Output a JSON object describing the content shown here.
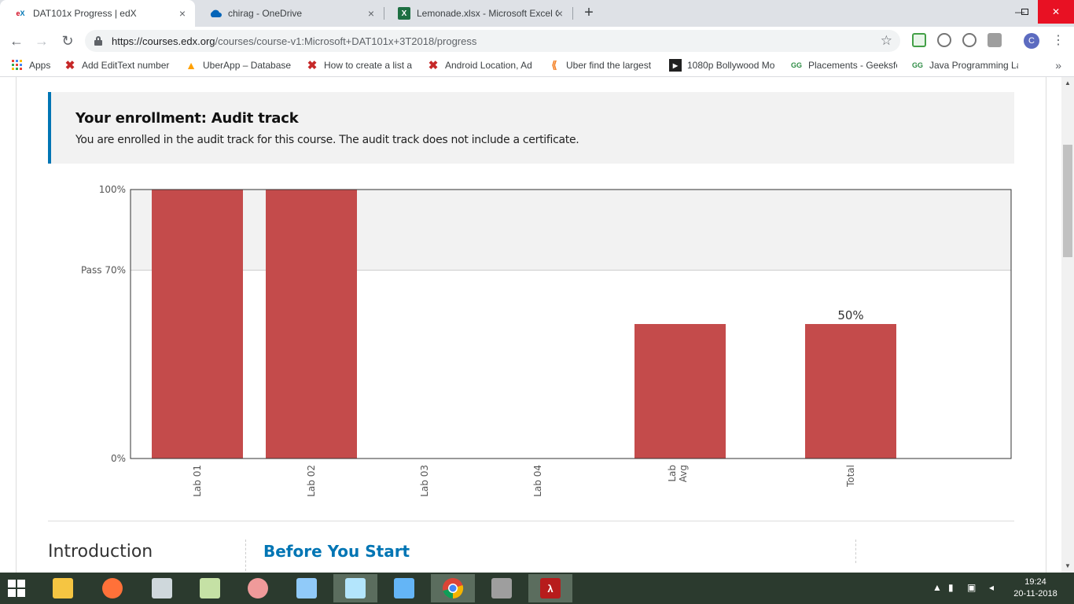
{
  "browser": {
    "tabs": [
      {
        "title": "DAT101x Progress | edX",
        "icon": "edx-favicon",
        "active": true
      },
      {
        "title": "chirag - OneDrive",
        "icon": "onedrive-cloud-icon",
        "active": false
      },
      {
        "title": "Lemonade.xlsx - Microsoft Excel O",
        "icon": "excel-icon",
        "active": false
      }
    ],
    "new_tab_symbol": "+",
    "close_symbol": "×",
    "url_domain": "https://courses.edx.org",
    "url_path": "/courses/course-v1:Microsoft+DAT101x+3T2018/progress",
    "profile_initial": "C"
  },
  "bookmarks": [
    {
      "label": "Apps",
      "icon": "apps-grid-icon"
    },
    {
      "label": "Add EditText number",
      "icon": "x-logo-icon"
    },
    {
      "label": "UberApp – Database",
      "icon": "firebase-icon"
    },
    {
      "label": "How to create a list a",
      "icon": "x-logo-icon"
    },
    {
      "label": "Android Location, Ad",
      "icon": "x-logo-icon"
    },
    {
      "label": "Uber find the largest",
      "icon": "stackoverflow-icon"
    },
    {
      "label": "1080p Bollywood Mo",
      "icon": "play-icon"
    },
    {
      "label": "Placements - Geeksfc",
      "icon": "geeksforgeeks-icon"
    },
    {
      "label": "Java Programming La",
      "icon": "geeksforgeeks-icon"
    }
  ],
  "enrollment": {
    "title": "Your enrollment: Audit track",
    "message": "You are enrolled in the audit track for this course. The audit track does not include a certificate."
  },
  "chart_data": {
    "type": "bar",
    "categories": [
      "Lab 01",
      "Lab 02",
      "Lab 03",
      "Lab 04",
      "Lab Avg",
      "Total"
    ],
    "values": [
      100,
      100,
      0,
      0,
      50,
      50
    ],
    "ylim": [
      0,
      100
    ],
    "y_tick_labels": [
      "0%",
      "Pass 70%",
      "100%"
    ],
    "y_tick_values": [
      0,
      70,
      100
    ],
    "pass_threshold": 70,
    "data_labels": [
      {
        "category": "Total",
        "text": "50%"
      }
    ],
    "bar_color": "#c44b4b",
    "pass_region_color": "#f2f2f2"
  },
  "course": {
    "section_title": "Introduction",
    "subsection_title": "Before You Start"
  },
  "taskbar": {
    "apps": [
      "file-explorer-icon",
      "firefox-icon",
      "task-manager-icon",
      "sticky-notes-icon",
      "snipping-tool-icon",
      "calculator-icon",
      "notepad-icon",
      "control-panel-icon",
      "chrome-icon",
      "wall-icon",
      "acrobat-icon"
    ],
    "time": "19:24",
    "date": "20-11-2018"
  }
}
